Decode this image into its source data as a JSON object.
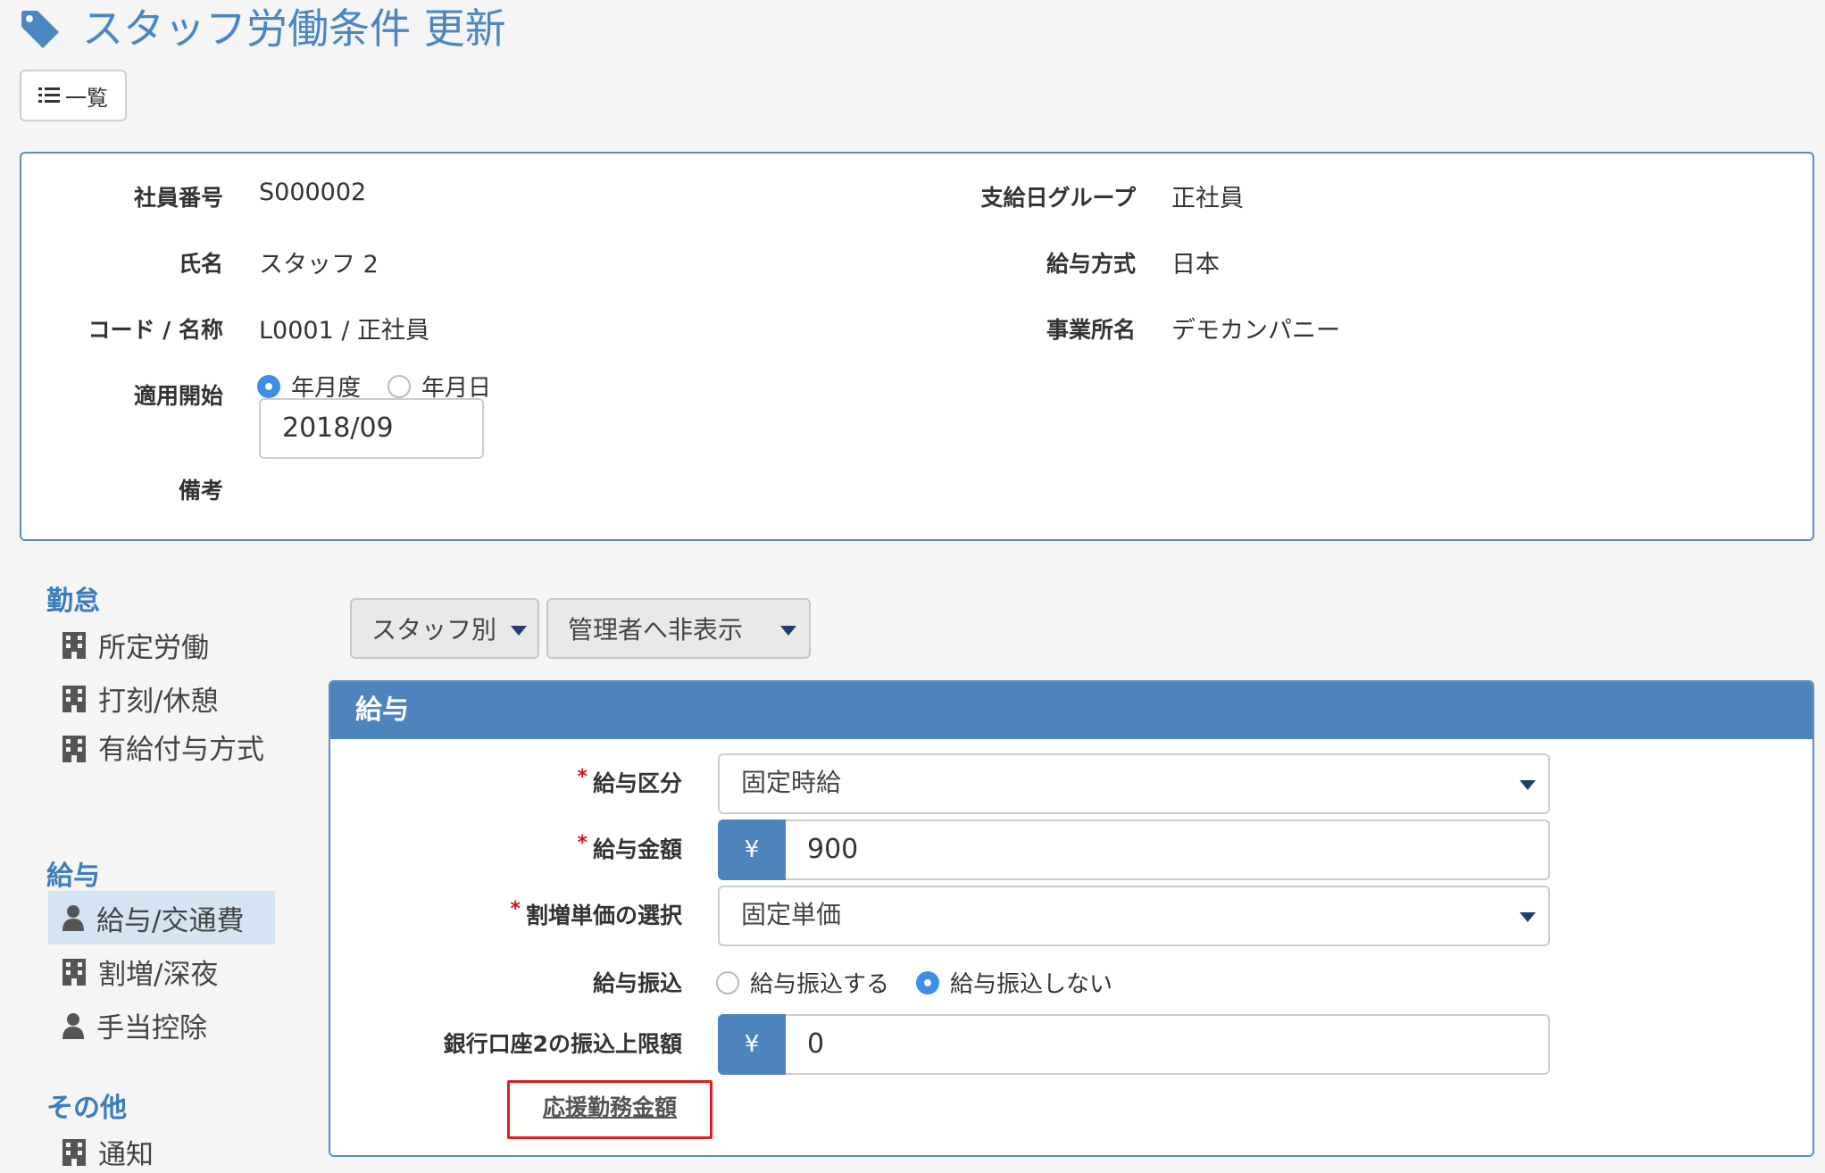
{
  "header": {
    "title": "スタッフ労働条件 更新",
    "list_button": "一覧"
  },
  "info": {
    "employee_no_label": "社員番号",
    "employee_no": "S000002",
    "name_label": "氏名",
    "name": "スタッフ 2",
    "code_label": "コード / 名称",
    "code": "L0001 / 正社員",
    "apply_start_label": "適用開始",
    "radio_month": "年月度",
    "radio_date": "年月日",
    "apply_date": "2018/09",
    "remarks_label": "備考",
    "pay_group_label": "支給日グループ",
    "pay_group": "正社員",
    "pay_method_label": "給与方式",
    "pay_method": "日本",
    "office_label": "事業所名",
    "office": "デモカンパニー"
  },
  "sidebar": {
    "section_attendance": "勤怠",
    "item_work": "所定労働",
    "item_stamp": "打刻/休憩",
    "item_paid_leave": "有給付与方式",
    "section_salary": "給与",
    "item_salary_transport": "給与/交通費",
    "item_premium": "割増/深夜",
    "item_allowance": "手当控除",
    "section_other": "その他",
    "item_notice": "通知"
  },
  "toolbar": {
    "staff_dropdown": "スタッフ別",
    "visibility_dropdown": "管理者へ非表示"
  },
  "salary": {
    "panel_title": "給与",
    "required_mark": "*",
    "type_label": "給与区分",
    "type_value": "固定時給",
    "amount_label": "給与金額",
    "currency": "¥",
    "amount_value": "900",
    "premium_label": "割増単価の選択",
    "premium_value": "固定単価",
    "transfer_label": "給与振込",
    "transfer_yes": "給与振込する",
    "transfer_no": "給与振込しない",
    "bank2_label": "銀行口座2の振込上限額",
    "bank2_value": "0",
    "support_link": "応援勤務金額"
  },
  "colors": {
    "accent": "#4e84be",
    "title": "#4a86c0",
    "highlight_box": "#e01e1e"
  }
}
